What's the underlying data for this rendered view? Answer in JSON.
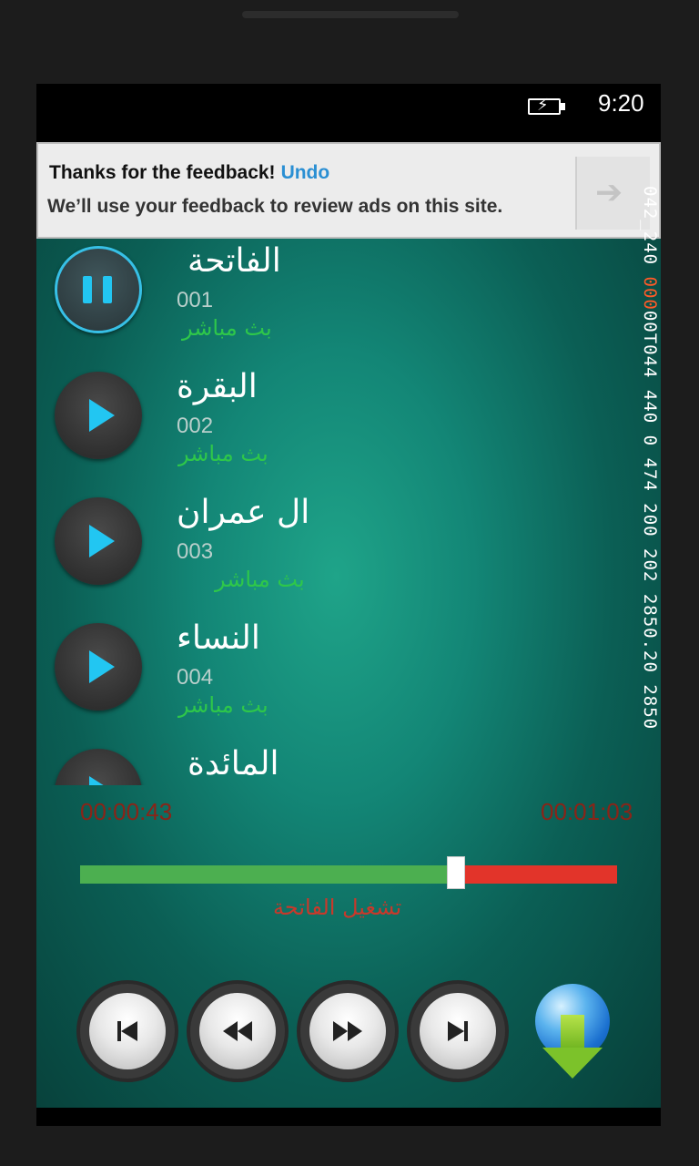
{
  "status_bar": {
    "time": "9:20",
    "battery_icon": "battery-charging-icon"
  },
  "ad_banner": {
    "title": "Thanks for the feedback!",
    "undo_label": "Undo",
    "message": "We’ll use your feedback to review ads on this site."
  },
  "debug_overlay": {
    "text_a": "042_240 ",
    "text_b": "000",
    "text_c": "00T044 440 0 474 200 202 2850.20 2850"
  },
  "playlist": [
    {
      "name": "الفاتحة",
      "number": "001",
      "status": "بث مباشر",
      "state": "playing"
    },
    {
      "name": "البقرة",
      "number": "002",
      "status": "بث مباشر",
      "state": "stopped"
    },
    {
      "name": "ال عمران",
      "number": "003",
      "status": "بث مباشر",
      "state": "stopped"
    },
    {
      "name": "النساء",
      "number": "004",
      "status": "بث مباشر",
      "state": "stopped"
    },
    {
      "name": "المائدة",
      "number": "",
      "status": "",
      "state": "stopped"
    }
  ],
  "player": {
    "elapsed": "00:00:43",
    "duration": "00:01:03",
    "progress_fraction": 0.683,
    "now_playing": "تشغيل  الفاتحة"
  },
  "controls": {
    "previous_icon": "skip-previous-icon",
    "rewind_icon": "rewind-icon",
    "fast_forward_icon": "fast-forward-icon",
    "next_icon": "skip-next-icon",
    "download_icon": "globe-download-icon"
  },
  "colors": {
    "accent_blue": "#22c6f2",
    "live_green": "#2ec74a",
    "progress_played": "#4caf50",
    "progress_remaining": "#e2342a",
    "time_text": "#8a2418"
  }
}
